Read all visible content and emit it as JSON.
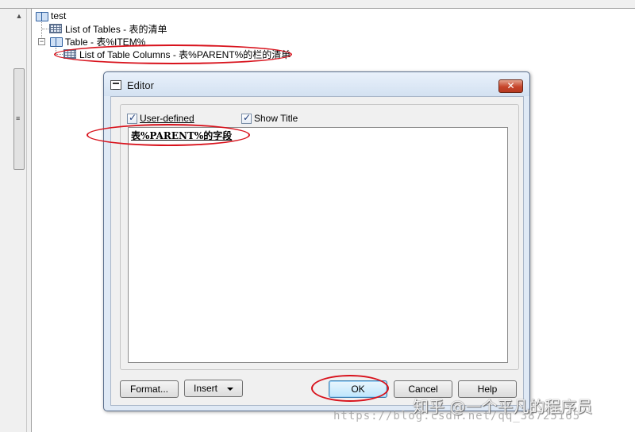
{
  "tree": {
    "root_label": "test",
    "items": [
      {
        "label": "List of Tables - 表的清单"
      },
      {
        "label": "Table - 表%ITEM%"
      },
      {
        "label": "List of Table Columns - 表%PARENT%的栏的清单"
      }
    ],
    "expander_symbol": "−"
  },
  "scrollbar": {
    "up_arrow": "▲",
    "grip": "≡"
  },
  "dialog": {
    "title": "Editor",
    "close_symbol": "✕",
    "user_defined_label": "User-defined",
    "user_defined_checked": true,
    "show_title_label": "Show Title",
    "show_title_checked": true,
    "editor_content": "表%PARENT%的字段",
    "buttons": {
      "format": "Format...",
      "insert": "Insert",
      "ok": "OK",
      "cancel": "Cancel",
      "help": "Help"
    }
  },
  "annotation_color": "#d8121c",
  "watermark": {
    "zhihu": "知乎 @一个平凡的程序员",
    "url": "https://blog.csdn.net/qq_38725165"
  }
}
